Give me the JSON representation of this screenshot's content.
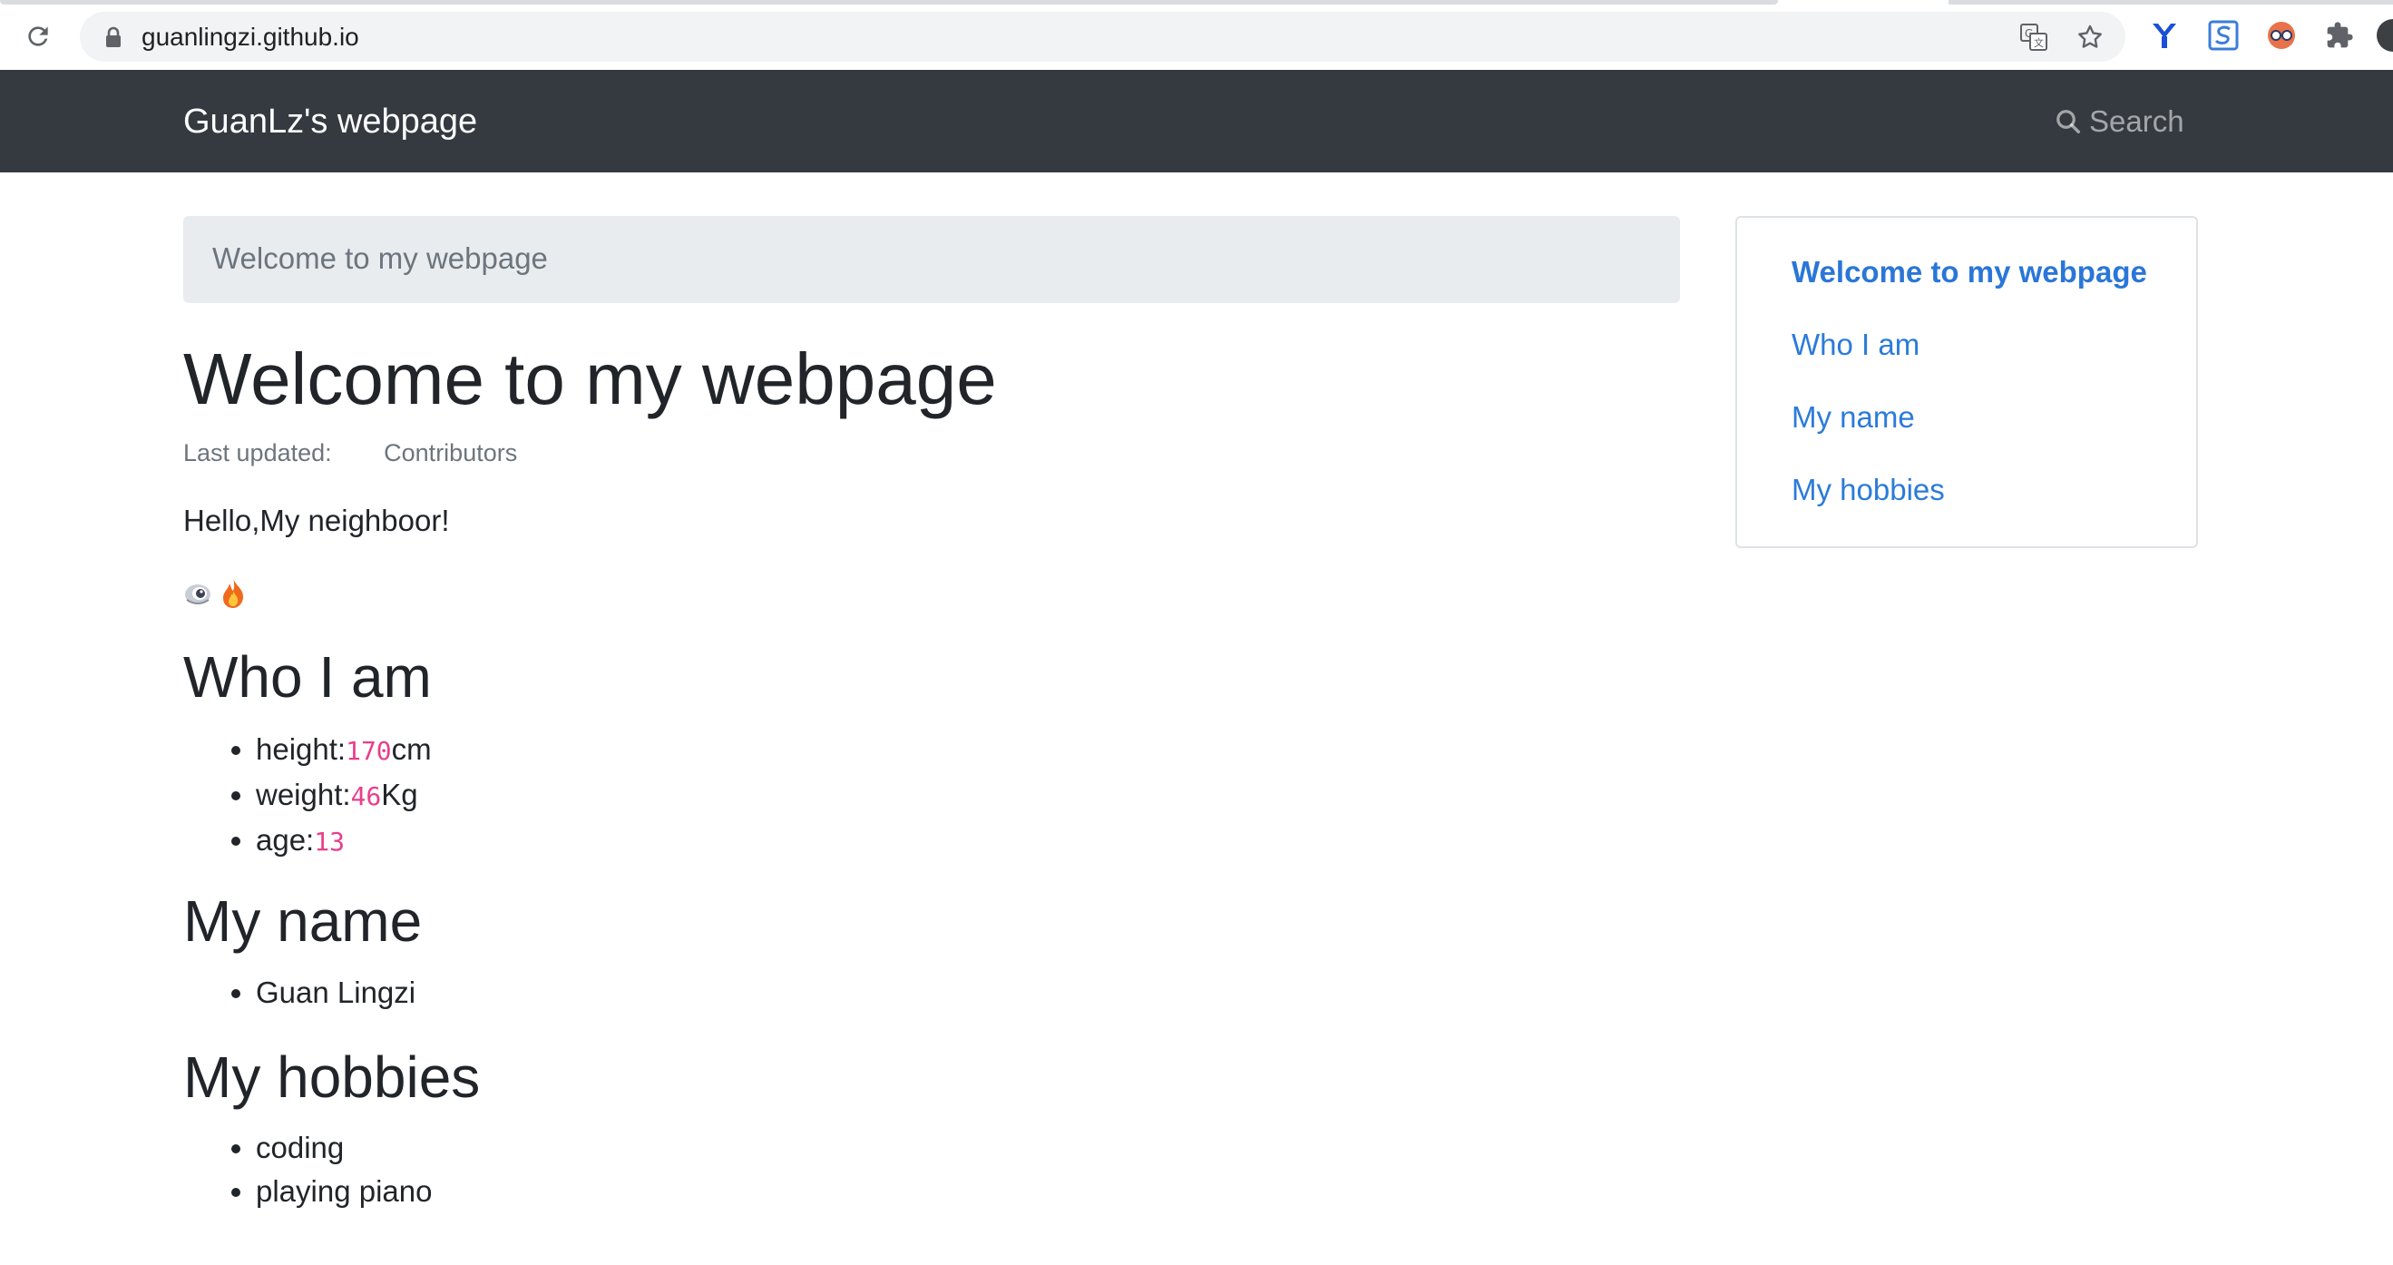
{
  "browser": {
    "url": "guanlingzi.github.io"
  },
  "navbar": {
    "brand": "GuanLz's webpage",
    "search_label": "Search"
  },
  "breadcrumb": {
    "current": "Welcome to my webpage"
  },
  "page": {
    "title": "Welcome to my webpage",
    "last_updated_label": "Last updated:",
    "contributors_label": "Contributors",
    "greeting": "Hello,My neighboor!",
    "emoji_icons": [
      "eye-icon",
      "fire-icon"
    ]
  },
  "sections": {
    "who": {
      "heading": "Who I am",
      "items": [
        {
          "label": "height:",
          "value": "170",
          "unit": "cm"
        },
        {
          "label": "weight:",
          "value": "46",
          "unit": "Kg"
        },
        {
          "label": "age:",
          "value": "13",
          "unit": ""
        }
      ]
    },
    "name": {
      "heading": "My name",
      "items": [
        "Guan Lingzi"
      ]
    },
    "hobbies": {
      "heading": "My hobbies",
      "items": [
        "coding",
        "playing piano"
      ]
    }
  },
  "toc": {
    "items": [
      "Welcome to my webpage",
      "Who I am",
      "My name",
      "My hobbies"
    ]
  },
  "colors": {
    "navbar_bg": "#343a40",
    "link": "#2b7bd9",
    "code": "#e83e8c",
    "breadcrumb_bg": "#e9ecef"
  }
}
